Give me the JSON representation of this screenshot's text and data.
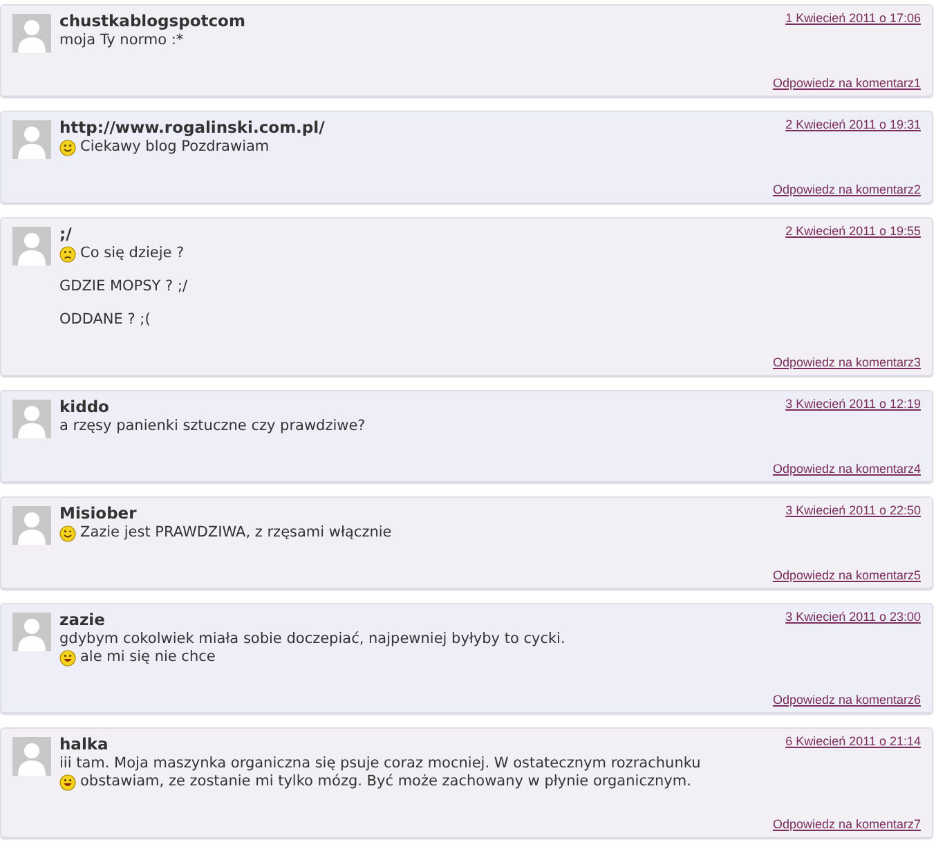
{
  "comments": [
    {
      "author": "chustkablogspotcom",
      "date": "1 Kwiecień 2011 o 17:06",
      "paragraphs": [
        {
          "lines": [
            {
              "kind": "plain",
              "text": "moja Ty normo :*"
            }
          ]
        }
      ],
      "reply": "Odpowiedz na komentarz1"
    },
    {
      "author": "http://www.rogalinski.com.pl/",
      "date": "2 Kwiecień 2011 o 19:31",
      "paragraphs": [
        {
          "lines": [
            {
              "kind": "smile",
              "text": "Ciekawy blog Pozdrawiam"
            }
          ]
        }
      ],
      "reply": "Odpowiedz na komentarz2"
    },
    {
      "author": ";/",
      "date": "2 Kwiecień 2011 o 19:55",
      "paragraphs": [
        {
          "lines": [
            {
              "kind": "sad",
              "text": "Co się dzieje ?"
            }
          ]
        },
        {
          "lines": [
            {
              "kind": "plain",
              "text": "GDZIE MOPSY ? ;/"
            }
          ]
        },
        {
          "lines": [
            {
              "kind": "plain",
              "text": "ODDANE ? ;("
            }
          ]
        }
      ],
      "reply": "Odpowiedz na komentarz3"
    },
    {
      "author": "kiddo",
      "date": "3 Kwiecień 2011 o 12:19",
      "paragraphs": [
        {
          "lines": [
            {
              "kind": "plain",
              "text": "a rzęsy panienki sztuczne czy prawdziwe?"
            }
          ]
        }
      ],
      "reply": "Odpowiedz na komentarz4"
    },
    {
      "author": "Misiober",
      "date": "3 Kwiecień 2011 o 22:50",
      "paragraphs": [
        {
          "lines": [
            {
              "kind": "wink",
              "text": "Zazie jest PRAWDZIWA, z rzęsami włącznie"
            }
          ]
        }
      ],
      "reply": "Odpowiedz na komentarz5"
    },
    {
      "author": "zazie",
      "date": "3 Kwiecień 2011 o 23:00",
      "paragraphs": [
        {
          "lines": [
            {
              "kind": "plain",
              "text": "gdybym cokolwiek miała sobie doczepiać, najpewniej byłyby to cycki."
            },
            {
              "kind": "grin",
              "text": "ale mi się nie chce"
            }
          ]
        }
      ],
      "reply": "Odpowiedz na komentarz6"
    },
    {
      "author": "halka",
      "date": "6 Kwiecień 2011 o 21:14",
      "paragraphs": [
        {
          "lines": [
            {
              "kind": "plain",
              "text": "iii tam. Moja maszynka organiczna się psuje coraz mocniej. W ostatecznym rozrachunku"
            },
            {
              "kind": "grin",
              "text": "obstawiam, ze zostanie mi tylko mózg. Być może zachowany w płynie organicznym."
            }
          ]
        }
      ],
      "reply": "Odpowiedz na komentarz7"
    }
  ]
}
